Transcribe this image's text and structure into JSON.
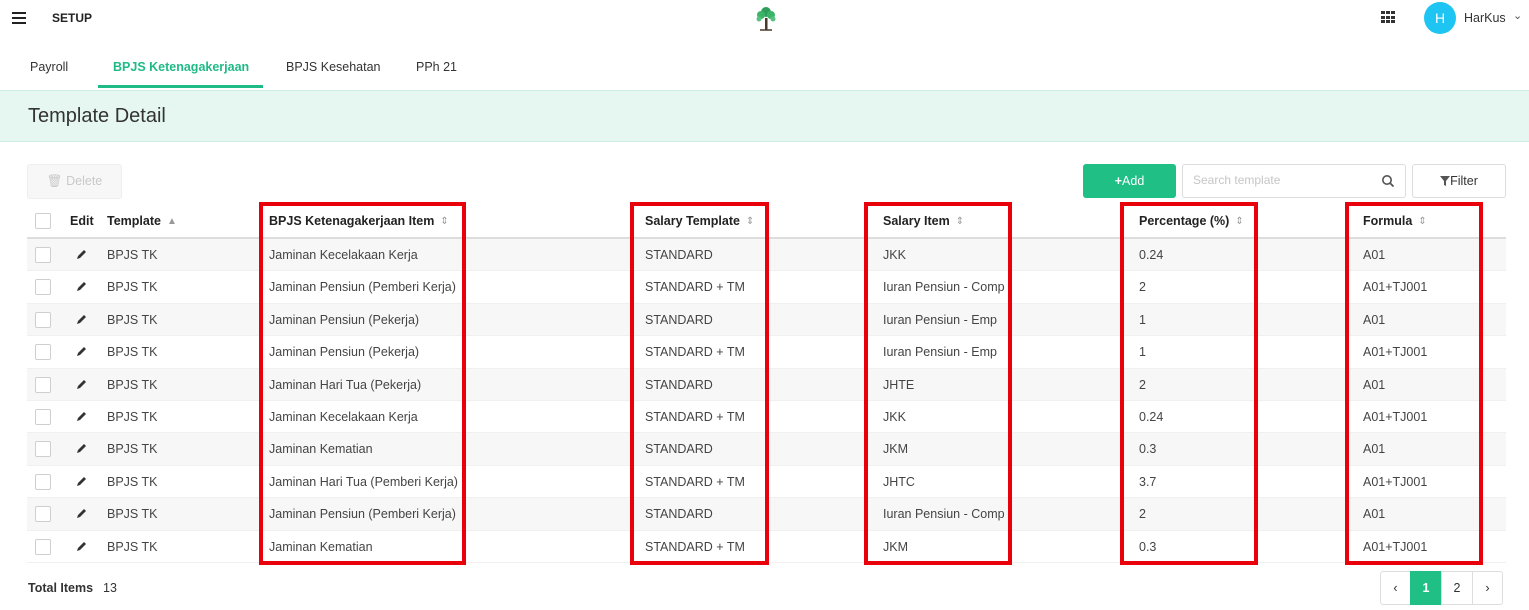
{
  "topbar": {
    "title": "SETUP",
    "user_initial": "H",
    "user_name": "HarKus"
  },
  "tabs": [
    {
      "label": "Payroll",
      "active": false
    },
    {
      "label": "BPJS Ketenagakerjaan",
      "active": true
    },
    {
      "label": "BPJS Kesehatan",
      "active": false
    },
    {
      "label": "PPh 21",
      "active": false
    }
  ],
  "page": {
    "title": "Template Detail"
  },
  "toolbar": {
    "delete_label": "Delete",
    "add_label": "Add",
    "search_placeholder": "Search template",
    "filter_label": "Filter"
  },
  "table": {
    "columns": {
      "edit": "Edit",
      "template": "Template",
      "item": "BPJS Ketenagakerjaan Item",
      "salary_template": "Salary Template",
      "salary_item": "Salary Item",
      "percentage": "Percentage (%)",
      "formula": "Formula"
    },
    "rows": [
      {
        "template": "BPJS TK",
        "item": "Jaminan Kecelakaan Kerja",
        "salary_template": "STANDARD",
        "salary_item": "JKK",
        "percentage": "0.24",
        "formula": "A01"
      },
      {
        "template": "BPJS TK",
        "item": "Jaminan Pensiun (Pemberi Kerja)",
        "salary_template": "STANDARD + TM",
        "salary_item": "Iuran Pensiun - Comp",
        "percentage": "2",
        "formula": "A01+TJ001"
      },
      {
        "template": "BPJS TK",
        "item": "Jaminan Pensiun (Pekerja)",
        "salary_template": "STANDARD",
        "salary_item": "Iuran Pensiun - Emp",
        "percentage": "1",
        "formula": "A01"
      },
      {
        "template": "BPJS TK",
        "item": "Jaminan Pensiun (Pekerja)",
        "salary_template": "STANDARD + TM",
        "salary_item": "Iuran Pensiun - Emp",
        "percentage": "1",
        "formula": "A01+TJ001"
      },
      {
        "template": "BPJS TK",
        "item": "Jaminan Hari Tua (Pekerja)",
        "salary_template": "STANDARD",
        "salary_item": "JHTE",
        "percentage": "2",
        "formula": "A01"
      },
      {
        "template": "BPJS TK",
        "item": "Jaminan Kecelakaan Kerja",
        "salary_template": "STANDARD + TM",
        "salary_item": "JKK",
        "percentage": "0.24",
        "formula": "A01+TJ001"
      },
      {
        "template": "BPJS TK",
        "item": "Jaminan Kematian",
        "salary_template": "STANDARD",
        "salary_item": "JKM",
        "percentage": "0.3",
        "formula": "A01"
      },
      {
        "template": "BPJS TK",
        "item": "Jaminan Hari Tua (Pemberi Kerja)",
        "salary_template": "STANDARD + TM",
        "salary_item": "JHTC",
        "percentage": "3.7",
        "formula": "A01+TJ001"
      },
      {
        "template": "BPJS TK",
        "item": "Jaminan Pensiun (Pemberi Kerja)",
        "salary_template": "STANDARD",
        "salary_item": "Iuran Pensiun - Comp",
        "percentage": "2",
        "formula": "A01"
      },
      {
        "template": "BPJS TK",
        "item": "Jaminan Kematian",
        "salary_template": "STANDARD + TM",
        "salary_item": "JKM",
        "percentage": "0.3",
        "formula": "A01+TJ001"
      }
    ]
  },
  "footer": {
    "total_label": "Total Items",
    "total_value": "13",
    "pages": [
      "1",
      "2"
    ],
    "current_page": "1",
    "prev": "‹",
    "next": "›"
  },
  "colors": {
    "accent": "#1fbf86",
    "highlight_box": "#e8000b",
    "avatar": "#1ec5f2",
    "header_band": "#e6f7f1"
  }
}
